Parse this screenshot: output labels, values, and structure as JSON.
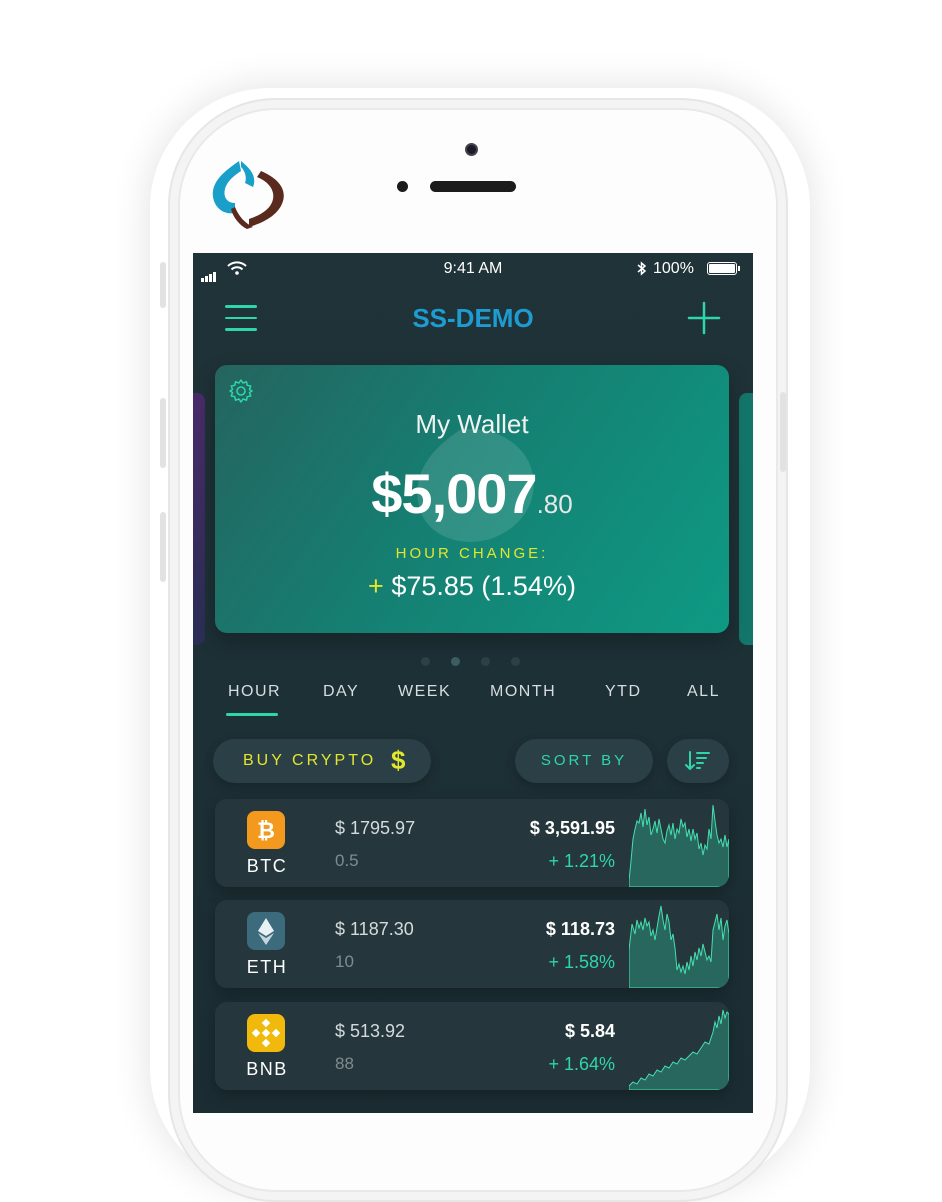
{
  "status_bar": {
    "time": "9:41 AM",
    "battery": "100%"
  },
  "header": {
    "title": "SS-DEMO"
  },
  "wallet": {
    "title": "My Wallet",
    "amount_main": "$5,007",
    "amount_cents": ".80",
    "change_label": "HOUR CHANGE:",
    "change_sign": "+",
    "change_value": "$75.85 (1.54%)"
  },
  "tabs": [
    {
      "label": "HOUR",
      "active": true
    },
    {
      "label": "DAY"
    },
    {
      "label": "WEEK"
    },
    {
      "label": "MONTH"
    },
    {
      "label": "YTD"
    },
    {
      "label": "ALL"
    }
  ],
  "actions": {
    "buy_label": "BUY CRYPTO",
    "buy_icon": "$",
    "sort_label": "SORT BY"
  },
  "coins": [
    {
      "symbol": "BTC",
      "price": "$ 1795.97",
      "qty": "0.5",
      "value": "$ 3,591.95",
      "change": "+ 1.21%",
      "color": "#f39a1e"
    },
    {
      "symbol": "ETH",
      "price": "$ 1187.30",
      "qty": "10",
      "value": "$ 118.73",
      "change": "+ 1.58%",
      "color": "#3b6b7d"
    },
    {
      "symbol": "BNB",
      "price": "$ 513.92",
      "qty": "88",
      "value": "$ 5.84",
      "change": "+ 1.64%",
      "color": "#f0b90b"
    }
  ],
  "colors": {
    "accent": "#2ed6a8",
    "title_blue": "#1e9bd0",
    "highlight_yellow": "#e4e62c"
  }
}
